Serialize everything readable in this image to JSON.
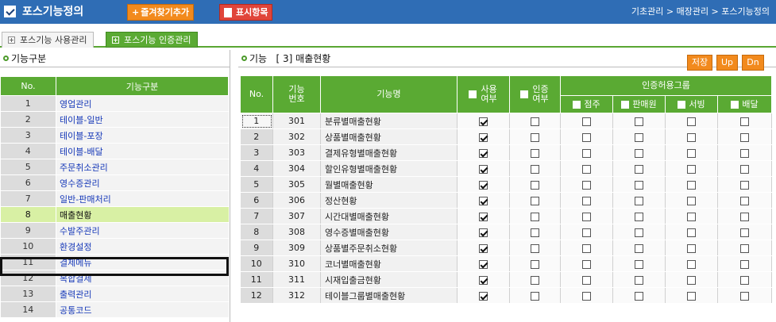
{
  "header": {
    "title": "포스기능정의",
    "favorite_button": "즐겨찾기추가",
    "display_button": "표시항목",
    "breadcrumb": "기초관리 > 매장관리 > 포스기능정의"
  },
  "tabs": [
    {
      "label": "포스기능 사용관리",
      "active": false
    },
    {
      "label": "포스기능 인증관리",
      "active": true
    }
  ],
  "left_panel": {
    "title": "기능구분",
    "columns": {
      "no": "No.",
      "name": "기능구분"
    },
    "rows": [
      {
        "no": "1",
        "name": "영업관리"
      },
      {
        "no": "2",
        "name": "테이블-일반"
      },
      {
        "no": "3",
        "name": "테이블-포장"
      },
      {
        "no": "4",
        "name": "테이블-배달"
      },
      {
        "no": "5",
        "name": "주문취소관리"
      },
      {
        "no": "6",
        "name": "영수증관리"
      },
      {
        "no": "7",
        "name": "일반-판매처리"
      },
      {
        "no": "8",
        "name": "매출현황"
      },
      {
        "no": "9",
        "name": "수발주관리"
      },
      {
        "no": "10",
        "name": "환경설정"
      },
      {
        "no": "11",
        "name": "결제메뉴"
      },
      {
        "no": "12",
        "name": "복합결제"
      },
      {
        "no": "13",
        "name": "출력관리"
      },
      {
        "no": "14",
        "name": "공통코드"
      }
    ],
    "selected_index": 7
  },
  "right_panel": {
    "title_prefix": "기능",
    "title_detail": "[ 3] 매출현황",
    "buttons": {
      "save": "저장",
      "up": "Up",
      "down": "Dn"
    },
    "columns": {
      "no": "No.",
      "code": "기능번호",
      "name": "기능명",
      "use": "사용여부",
      "cert": "인증여부",
      "group": "인증허용그룹",
      "g1": "점주",
      "g2": "판매원",
      "g3": "서빙",
      "g4": "배달"
    },
    "rows": [
      {
        "no": "1",
        "code": "301",
        "name": "분류별매출현황",
        "use": true,
        "cert": false
      },
      {
        "no": "2",
        "code": "302",
        "name": "상품별매출현황",
        "use": true,
        "cert": false
      },
      {
        "no": "3",
        "code": "303",
        "name": "결제유형별매출현황",
        "use": true,
        "cert": false
      },
      {
        "no": "4",
        "code": "304",
        "name": "할인유형별매출현황",
        "use": true,
        "cert": false
      },
      {
        "no": "5",
        "code": "305",
        "name": "월별매출현황",
        "use": true,
        "cert": false
      },
      {
        "no": "6",
        "code": "306",
        "name": "정산현황",
        "use": true,
        "cert": false
      },
      {
        "no": "7",
        "code": "307",
        "name": "시간대별매출현황",
        "use": true,
        "cert": false
      },
      {
        "no": "8",
        "code": "308",
        "name": "영수증별매출현황",
        "use": true,
        "cert": false
      },
      {
        "no": "9",
        "code": "309",
        "name": "상품별주문취소현황",
        "use": true,
        "cert": false
      },
      {
        "no": "10",
        "code": "310",
        "name": "코너별매출현황",
        "use": true,
        "cert": false
      },
      {
        "no": "11",
        "code": "311",
        "name": "시재입출금현황",
        "use": true,
        "cert": false
      },
      {
        "no": "12",
        "code": "312",
        "name": "테이블그룹별매출현황",
        "use": true,
        "cert": false
      }
    ]
  },
  "colors": {
    "header_bg": "#2f6db5",
    "accent_green": "#5aaa33",
    "orange": "#f28a1d",
    "red": "#e0453a",
    "selected_row": "#d8f0a4",
    "link": "#1638b8"
  }
}
